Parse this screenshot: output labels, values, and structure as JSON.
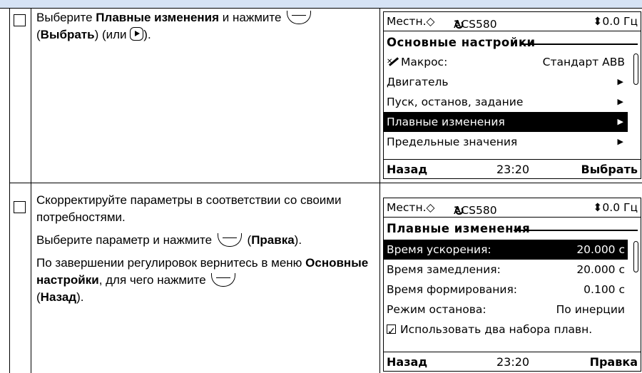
{
  "step1": {
    "instruction": {
      "part1": "Выберите ",
      "bold1": "Плавные изменения",
      "part2": " и нажмите ",
      "paren_open": " (",
      "bold2": "Выбрать",
      "part3": ") (или ",
      "part4": ")."
    },
    "screen": {
      "mode": "Местн.◇",
      "drive": "ACS580",
      "freq": "⬍0.0 Гц",
      "title": "Основные настройки",
      "items": [
        {
          "label": "Макрос:",
          "value": "Стандарт ABB",
          "icon": "wand-icon"
        },
        {
          "label": "Двигатель",
          "arrow": "▶"
        },
        {
          "label": "Пуск, останов, задание",
          "arrow": "▶"
        },
        {
          "label": "Плавные изменения",
          "arrow": "▶",
          "selected": true
        },
        {
          "label": "Предельные значения",
          "arrow": "▶"
        }
      ],
      "back": "Назад",
      "time": "23:20",
      "action": "Выбрать"
    }
  },
  "step2": {
    "instruction": {
      "p1": "Скорректируйте параметры в соответствии со своими потребностями.",
      "p2a": "Выберите параметр и нажмите ",
      "p2b": " (",
      "p2bold": "Правка",
      "p2c": ").",
      "p3a": "По завершении регулировок вернитесь в меню ",
      "p3bold": "Основные настройки",
      "p3b": ", для чего нажмите ",
      "p3c": " (",
      "p3bold2": "Назад",
      "p3d": ")."
    },
    "screen": {
      "mode": "Местн.◇",
      "drive": "ACS580",
      "freq": "⬍0.0 Гц",
      "title": "Плавные изменения",
      "items": [
        {
          "label": "Время ускорения:",
          "value": "20.000 с",
          "selected": true
        },
        {
          "label": "Время замедления:",
          "value": "20.000 с"
        },
        {
          "label": "Время формирования:",
          "value": "0.100 с"
        },
        {
          "label": "Режим останова:",
          "value": "По инерции"
        },
        {
          "label": "Использовать два набора плавн.",
          "checkbox": true
        }
      ],
      "back": "Назад",
      "time": "23:20",
      "action": "Правка"
    }
  }
}
